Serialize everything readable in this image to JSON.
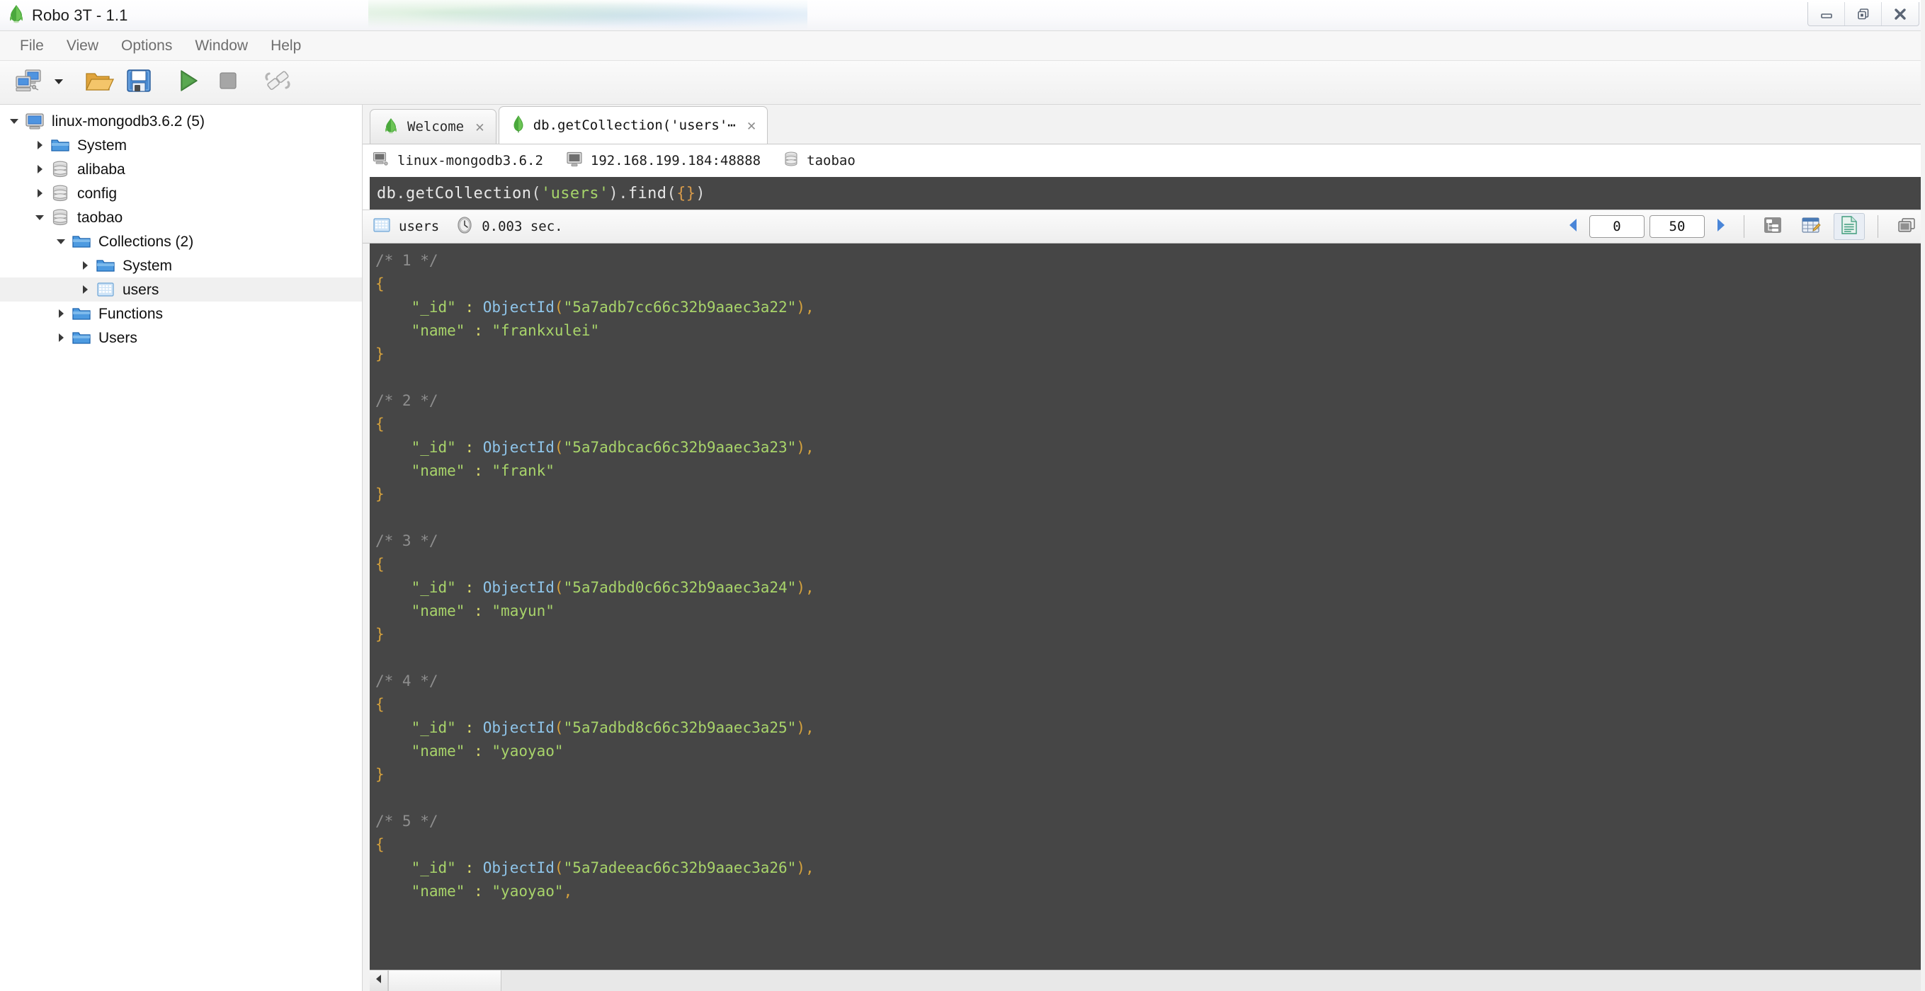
{
  "window": {
    "title": "Robo 3T - 1.1",
    "app_icon": "robo3t-leaf-icon",
    "controls": [
      {
        "name": "minimize-button",
        "icon": "minimize-icon"
      },
      {
        "name": "restore-button",
        "icon": "restore-icon"
      },
      {
        "name": "close-button",
        "icon": "close-icon"
      }
    ]
  },
  "menubar": {
    "items": [
      {
        "label": "File"
      },
      {
        "label": "View"
      },
      {
        "label": "Options"
      },
      {
        "label": "Window"
      },
      {
        "label": "Help"
      }
    ]
  },
  "toolbar": {
    "buttons": [
      {
        "name": "connect-button",
        "icon": "computers-connect-icon",
        "tooltip": "Connect"
      },
      {
        "name": "connect-dropdown",
        "icon": "chevron-down-icon",
        "tooltip": "Recent connections"
      },
      {
        "name": "open-script-button",
        "icon": "open-folder-icon",
        "tooltip": "Open Script"
      },
      {
        "name": "save-script-button",
        "icon": "floppy-save-icon",
        "tooltip": "Save Script"
      },
      {
        "name": "execute-button",
        "icon": "green-play-icon",
        "tooltip": "Execute"
      },
      {
        "name": "stop-button",
        "icon": "gray-stop-icon",
        "tooltip": "Stop"
      },
      {
        "name": "disconnect-button",
        "icon": "broken-link-icon",
        "tooltip": "Disconnect"
      }
    ]
  },
  "sidebar": {
    "tree": [
      {
        "label": "linux-mongodb3.6.2 (5)",
        "icon": "server-icon",
        "depth": 0,
        "twisty": "open",
        "selected": false
      },
      {
        "label": "System",
        "icon": "folder-icon",
        "depth": 1,
        "twisty": "closed",
        "selected": false
      },
      {
        "label": "alibaba",
        "icon": "database-icon",
        "depth": 1,
        "twisty": "closed",
        "selected": false
      },
      {
        "label": "config",
        "icon": "database-icon",
        "depth": 1,
        "twisty": "closed",
        "selected": false
      },
      {
        "label": "taobao",
        "icon": "database-icon",
        "depth": 1,
        "twisty": "open",
        "selected": false
      },
      {
        "label": "Collections (2)",
        "icon": "folder-icon",
        "depth": 2,
        "twisty": "open",
        "selected": false
      },
      {
        "label": "System",
        "icon": "folder-icon",
        "depth": 3,
        "twisty": "closed",
        "selected": false
      },
      {
        "label": "users",
        "icon": "collection-icon",
        "depth": 3,
        "twisty": "closed",
        "selected": true
      },
      {
        "label": "Functions",
        "icon": "folder-icon",
        "depth": 2,
        "twisty": "closed",
        "selected": false
      },
      {
        "label": "Users",
        "icon": "folder-icon",
        "depth": 2,
        "twisty": "closed",
        "selected": false
      }
    ]
  },
  "tabs": [
    {
      "label": "Welcome",
      "icon": "robo3t-leaf-icon",
      "active": false,
      "close": "✕"
    },
    {
      "label": "db.getCollection('users'⋯",
      "icon": "mongo-leaf-icon",
      "active": true,
      "close": "✕"
    }
  ],
  "connection_bar": {
    "server": {
      "icon": "server-small-icon",
      "label": "linux-mongodb3.6.2"
    },
    "host": {
      "icon": "monitor-icon",
      "label": "192.168.199.184:48888"
    },
    "database": {
      "icon": "database-small-icon",
      "label": "taobao"
    }
  },
  "editor": {
    "tokens": [
      {
        "t": "db",
        "c": "tok-obj"
      },
      {
        "t": ".",
        "c": "tok-punct"
      },
      {
        "t": "getCollection",
        "c": "tok-fn"
      },
      {
        "t": "(",
        "c": "tok-paren"
      },
      {
        "t": "'users'",
        "c": "tok-str"
      },
      {
        "t": ")",
        "c": "tok-paren"
      },
      {
        "t": ".",
        "c": "tok-punct"
      },
      {
        "t": "find",
        "c": "tok-fn"
      },
      {
        "t": "(",
        "c": "tok-paren"
      },
      {
        "t": "{}",
        "c": "tok-brace"
      },
      {
        "t": ")",
        "c": "tok-paren"
      }
    ],
    "plain_text": "db.getCollection('users').find({})"
  },
  "results_toolbar": {
    "collection_icon": "grid-collection-icon",
    "collection_name": "users",
    "clock_icon": "clock-icon",
    "elapsed": "0.003 sec.",
    "pager": {
      "prev_icon": "triangle-left-icon",
      "skip_value": "0",
      "limit_value": "50",
      "next_icon": "triangle-right-icon"
    },
    "view_modes": [
      {
        "name": "tree-view-button",
        "icon": "tree-view-icon",
        "active": false
      },
      {
        "name": "table-view-button",
        "icon": "table-view-icon",
        "active": false
      },
      {
        "name": "text-view-button",
        "icon": "text-view-icon",
        "active": true
      },
      {
        "name": "split-view-button",
        "icon": "split-view-icon",
        "active": false
      }
    ]
  },
  "results": {
    "documents": [
      {
        "comment": "/* 1 */",
        "id_field": "\"_id\"",
        "id_type": "ObjectId",
        "id_value": "\"5a7adb7cc66c32b9aaec3a22\"",
        "name_field": "\"name\"",
        "name_value": "\"frankxulei\"",
        "name_trailing": ""
      },
      {
        "comment": "/* 2 */",
        "id_field": "\"_id\"",
        "id_type": "ObjectId",
        "id_value": "\"5a7adbcac66c32b9aaec3a23\"",
        "name_field": "\"name\"",
        "name_value": "\"frank\"",
        "name_trailing": ""
      },
      {
        "comment": "/* 3 */",
        "id_field": "\"_id\"",
        "id_type": "ObjectId",
        "id_value": "\"5a7adbd0c66c32b9aaec3a24\"",
        "name_field": "\"name\"",
        "name_value": "\"mayun\"",
        "name_trailing": ""
      },
      {
        "comment": "/* 4 */",
        "id_field": "\"_id\"",
        "id_type": "ObjectId",
        "id_value": "\"5a7adbd8c66c32b9aaec3a25\"",
        "name_field": "\"name\"",
        "name_value": "\"yaoyao\"",
        "name_trailing": ""
      },
      {
        "comment": "/* 5 */",
        "id_field": "\"_id\"",
        "id_type": "ObjectId",
        "id_value": "\"5a7adeeac66c32b9aaec3a26\"",
        "name_field": "\"name\"",
        "name_value": "\"yaoyao\"",
        "name_trailing": ","
      }
    ],
    "open_brace": "{",
    "close_brace": "}",
    "colon": ":",
    "comma": ",",
    "open_paren": "(",
    "close_paren": ")"
  },
  "hscroll": {
    "left_arrow_icon": "triangle-left-small-icon"
  },
  "colors": {
    "editor_bg": "#464646",
    "accent_green": "#3f9b35",
    "string_green": "#a8d46a",
    "type_blue": "#8fc5ea",
    "brace_orange": "#d6a23c",
    "comment_gray": "#8e8e8e",
    "selection_gray": "#f0f0f0"
  }
}
